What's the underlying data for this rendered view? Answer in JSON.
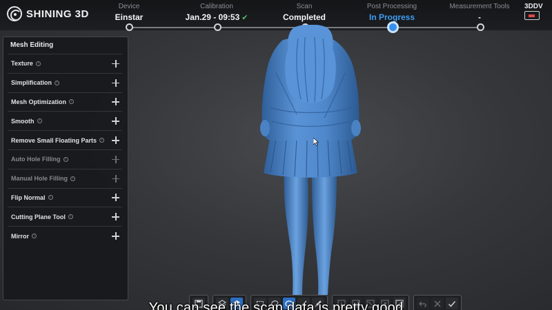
{
  "brand": {
    "name": "SHINING 3D"
  },
  "steps": [
    {
      "category": "Device",
      "value": "Einstar",
      "state": "done"
    },
    {
      "category": "Calibration",
      "value": "Jan.29 - 09:53",
      "state": "done-check"
    },
    {
      "category": "Scan",
      "value": "Completed",
      "state": "done"
    },
    {
      "category": "Post Processing",
      "value": "In Progress",
      "state": "active"
    },
    {
      "category": "Measurement Tools",
      "value": "-",
      "state": "pending"
    }
  ],
  "badge": {
    "top": "3D",
    "top_accent": "DV"
  },
  "panel": {
    "title": "Mesh Editing",
    "tools": [
      {
        "label": "Texture",
        "enabled": true
      },
      {
        "label": "Simplification",
        "enabled": true
      },
      {
        "label": "Mesh Optimization",
        "enabled": true
      },
      {
        "label": "Smooth",
        "enabled": true
      },
      {
        "label": "Remove Small Floating Parts",
        "enabled": true
      },
      {
        "label": "Auto Hole Filling",
        "enabled": false
      },
      {
        "label": "Manual Hole Filling",
        "enabled": false
      },
      {
        "label": "Flip Normal",
        "enabled": true
      },
      {
        "label": "Cutting Plane Tool",
        "enabled": true
      },
      {
        "label": "Mirror",
        "enabled": true
      }
    ],
    "info_glyph": "i"
  },
  "toolbar": {
    "groups": [
      [
        "save-icon"
      ],
      [
        "layers-icon",
        "layers-selected-icon"
      ],
      [
        "rect-select-icon",
        "lasso-select-icon",
        "ellipse-select-icon",
        "line-select-icon",
        "brush-select-icon"
      ],
      [
        "select-all-icon",
        "invert-select-icon",
        "deselect-icon",
        "reveal-icon",
        "hide-icon"
      ],
      [
        "undo-icon",
        "cancel-icon",
        "confirm-icon"
      ]
    ]
  },
  "colors": {
    "accent": "#3e9df3",
    "model": "#4a84c9",
    "check": "#4cc36a"
  },
  "caption": "You can see the scan data is pretty good"
}
